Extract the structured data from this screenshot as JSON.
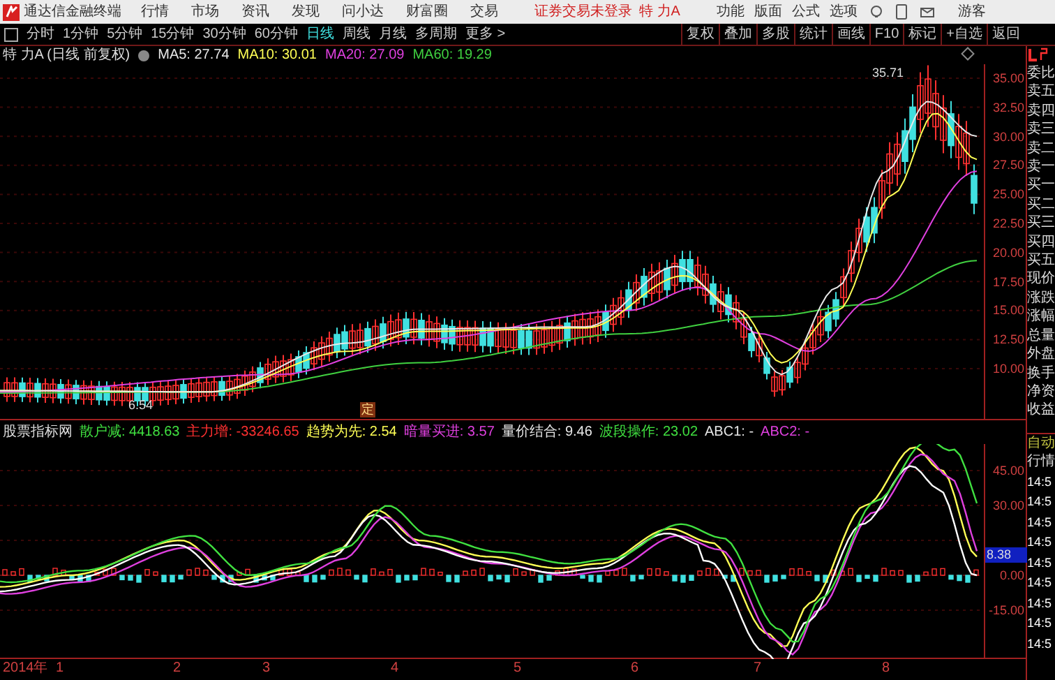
{
  "title_bar": {
    "app_name": "通达信金融终端",
    "menu": [
      "行情",
      "市场",
      "资讯",
      "发现",
      "问小达",
      "财富圈",
      "交易"
    ],
    "login_status": "证券交易未登录",
    "stock_name": "特 力A",
    "right_menu": [
      "功能",
      "版面",
      "公式",
      "选项"
    ],
    "user": "游客"
  },
  "period_tabs": [
    {
      "label": "分时",
      "selected": false
    },
    {
      "label": "1分钟",
      "selected": false
    },
    {
      "label": "5分钟",
      "selected": false
    },
    {
      "label": "15分钟",
      "selected": false
    },
    {
      "label": "30分钟",
      "selected": false
    },
    {
      "label": "60分钟",
      "selected": false
    },
    {
      "label": "日线",
      "selected": true
    },
    {
      "label": "周线",
      "selected": false
    },
    {
      "label": "月线",
      "selected": false
    },
    {
      "label": "多周期",
      "selected": false
    },
    {
      "label": "更多 >",
      "selected": false
    }
  ],
  "toolbar_buttons": [
    "复权",
    "叠加",
    "多股",
    "统计",
    "画线",
    "F10",
    "标记",
    "+自选",
    "返回"
  ],
  "main_chart": {
    "title": "特 力A (日线 前复权)",
    "ma": [
      {
        "label": "MA5: 27.74",
        "color": "#e8e8e8"
      },
      {
        "label": "MA10: 30.01",
        "color": "#ffff55"
      },
      {
        "label": "MA20: 27.09",
        "color": "#e040e0"
      },
      {
        "label": "MA60: 19.29",
        "color": "#40d040"
      }
    ],
    "price_ticks": [
      "35.00",
      "32.50",
      "30.00",
      "27.50",
      "25.00",
      "22.50",
      "20.00",
      "17.50",
      "15.00",
      "12.50",
      "10.00"
    ],
    "high_label": "35.71",
    "low_label": "6.54",
    "marker": "定"
  },
  "indicator": {
    "name": "股票指标网",
    "values": [
      {
        "label": "散户减:",
        "value": "4418.63",
        "color": "#40e040"
      },
      {
        "label": "主力增:",
        "value": "-33246.65",
        "color": "#ff3030"
      },
      {
        "label": "趋势为先:",
        "value": "2.54",
        "color": "#ffff55"
      },
      {
        "label": "暗量买进:",
        "value": "3.57",
        "color": "#e040e0"
      },
      {
        "label": "量价结合:",
        "value": "9.46",
        "color": "#e8e8e8"
      },
      {
        "label": "波段操作:",
        "value": "23.02",
        "color": "#40e040"
      },
      {
        "label": "ABC1:",
        "value": "-",
        "color": "#e8e8e8"
      },
      {
        "label": "ABC2:",
        "value": "-",
        "color": "#e040e0"
      }
    ],
    "ticks": [
      "45.00",
      "30.00",
      "0.00",
      "-15.00"
    ],
    "current_value": "8.38"
  },
  "time_axis": [
    "2014年",
    "1",
    "2",
    "3",
    "4",
    "5",
    "6",
    "7",
    "8"
  ],
  "quote_panel": {
    "labels": [
      "委比",
      "卖五",
      "卖四",
      "卖三",
      "卖二",
      "卖一",
      "买一",
      "买二",
      "买三",
      "买四",
      "买五",
      "现价",
      "涨跌",
      "涨幅",
      "总量",
      "外盘",
      "换手",
      "净资",
      "收益"
    ],
    "auto_label": "自动",
    "quote_label": "行情",
    "times": [
      "14:5",
      "14:5",
      "14:5",
      "14:5",
      "14:5",
      "14:5",
      "14:5",
      "14:5",
      "14:5"
    ]
  }
}
